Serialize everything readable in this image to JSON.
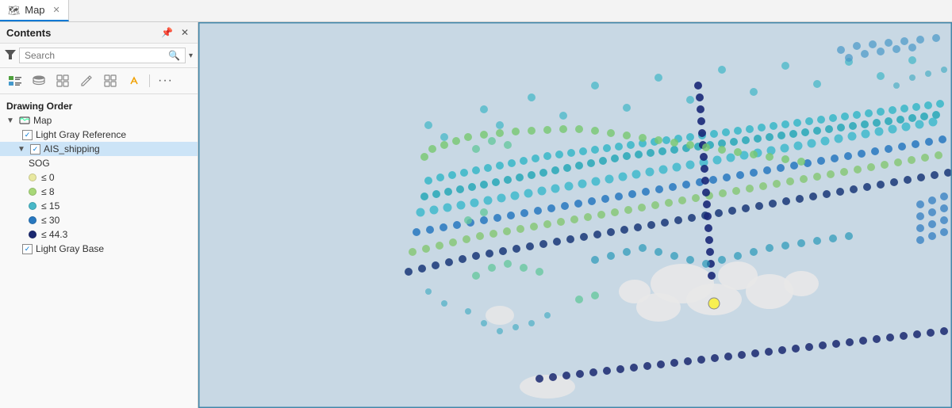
{
  "appBar": {
    "tabs": [
      {
        "id": "map-tab",
        "label": "Map",
        "icon": "🗺",
        "closable": true,
        "active": true
      }
    ]
  },
  "sidebar": {
    "title": "Contents",
    "searchPlaceholder": "Search",
    "sectionLabel": "Drawing Order",
    "filterIconLabel": "filter-icon",
    "toolbar": [
      {
        "id": "list-view-btn",
        "label": "☰",
        "title": "List by drawing order"
      },
      {
        "id": "db-view-btn",
        "label": "⊞",
        "title": "List by data source"
      },
      {
        "id": "selection-view-btn",
        "label": "⊡",
        "title": "List by selection"
      },
      {
        "id": "edit-view-btn",
        "label": "✎",
        "title": "List by editing"
      },
      {
        "id": "grid-view-btn",
        "label": "⊞",
        "title": "Show as grid"
      },
      {
        "id": "snapping-btn",
        "label": "◇",
        "title": "Snapping"
      },
      {
        "id": "more-btn",
        "label": "…",
        "title": "More"
      }
    ],
    "tree": {
      "mapItem": {
        "label": "Map",
        "expanded": true
      },
      "items": [
        {
          "id": "light-gray-reference",
          "label": "Light Gray Reference",
          "checked": true,
          "selected": false,
          "indent": 1
        },
        {
          "id": "ais-shipping",
          "label": "AIS_shipping",
          "checked": true,
          "selected": true,
          "indent": 1
        }
      ],
      "legendTitle": "SOG",
      "legendItems": [
        {
          "id": "sog-0",
          "label": "≤ 0",
          "color": "#e8e8a0"
        },
        {
          "id": "sog-8",
          "label": "≤ 8",
          "color": "#a8d878"
        },
        {
          "id": "sog-15",
          "label": "≤ 15",
          "color": "#48b8c8"
        },
        {
          "id": "sog-30",
          "label": "≤ 30",
          "color": "#2878c0"
        },
        {
          "id": "sog-44",
          "label": "≤ 44.3",
          "color": "#1a2870"
        }
      ],
      "bottomItems": [
        {
          "id": "light-gray-base",
          "label": "Light Gray Base",
          "checked": true,
          "selected": false,
          "indent": 1
        }
      ]
    }
  },
  "map": {
    "backgroundColor": "#c8d8e8"
  },
  "colors": {
    "accent": "#0078d4",
    "selectedBg": "#cce4f7",
    "sidebarBg": "#f9f9f9",
    "tabActiveBorder": "#0078d4"
  }
}
